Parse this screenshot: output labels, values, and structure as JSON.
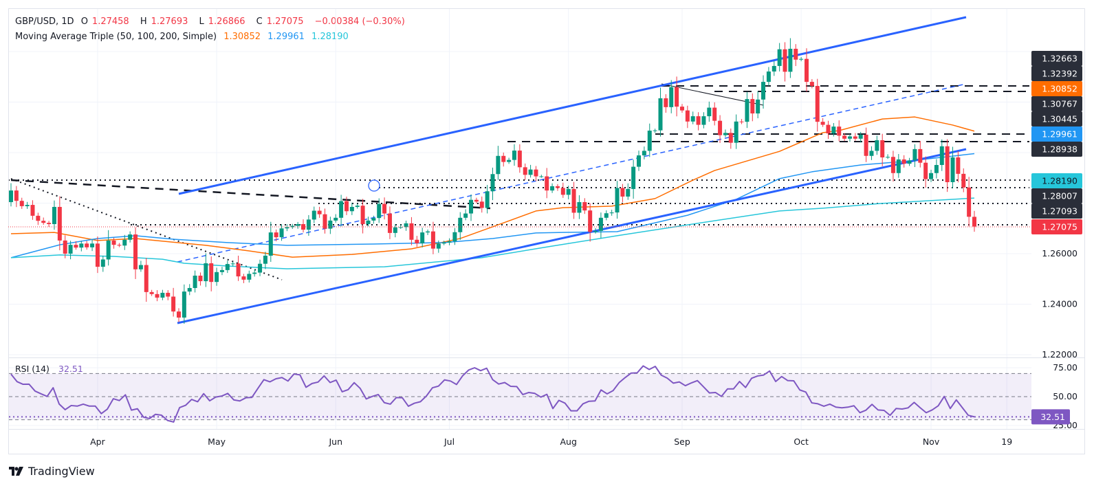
{
  "header": {
    "symbol": "GBP/USD, 1D",
    "open_label": "O",
    "open": "1.27458",
    "high_label": "H",
    "high": "1.27693",
    "low_label": "L",
    "low": "1.26866",
    "close_label": "C",
    "close": "1.27075",
    "change": "−0.00384 (−0.30%)",
    "ma_title": "Moving Average Triple (50, 100, 200, Simple)",
    "ma50_value": "1.30852",
    "ma100_value": "1.29961",
    "ma200_value": "1.28190"
  },
  "rsi_header": {
    "title": "RSI (14)",
    "value": "32.51"
  },
  "colors": {
    "up": "#089981",
    "down": "#f23645",
    "ma50": "#ff6d00",
    "ma100": "#2196f3",
    "ma200": "#26c6da",
    "channel": "#2962ff",
    "rsi": "#7e57c2",
    "label_dark": "#2a2e39"
  },
  "price_axis": {
    "ticks": [
      "1.26000",
      "1.24000",
      "1.22000"
    ]
  },
  "price_labels": [
    {
      "text": "1.32663",
      "kind": "level"
    },
    {
      "text": "1.32392",
      "kind": "level"
    },
    {
      "text": "1.30852",
      "kind": "ma50"
    },
    {
      "text": "1.30767",
      "kind": "level"
    },
    {
      "text": "1.30445",
      "kind": "level"
    },
    {
      "text": "1.29961",
      "kind": "ma100"
    },
    {
      "text": "1.28938",
      "kind": "level"
    },
    {
      "text": "1.28190",
      "kind": "ma200"
    },
    {
      "text": "1.28007",
      "kind": "level"
    },
    {
      "text": "1.27093",
      "kind": "level"
    },
    {
      "text": "1.27075",
      "kind": "last"
    }
  ],
  "rsi_axis": {
    "ticks": [
      "75.00",
      "50.00",
      "25.00"
    ],
    "current": "32.51"
  },
  "time_axis": [
    {
      "label": "Apr",
      "bar": 16
    },
    {
      "label": "May",
      "bar": 38
    },
    {
      "label": "Jun",
      "bar": 60
    },
    {
      "label": "Jul",
      "bar": 81
    },
    {
      "label": "Aug",
      "bar": 103
    },
    {
      "label": "Sep",
      "bar": 124
    },
    {
      "label": "Oct",
      "bar": 146
    },
    {
      "label": "Nov",
      "bar": 170
    },
    {
      "label": "19",
      "bar": 184
    }
  ],
  "branding": "TradingView",
  "chart_data": {
    "type": "candlestick",
    "symbol": "GBP/USD",
    "interval": "1D",
    "ylim": [
      1.215,
      1.36
    ],
    "first_open": 1.2804,
    "last_bar": {
      "open": 1.27458,
      "high": 1.27693,
      "low": 1.26866,
      "close": 1.27075
    },
    "closes": [
      1.285,
      1.2809,
      1.2788,
      1.2793,
      1.275,
      1.273,
      1.2722,
      1.2717,
      1.2785,
      1.2652,
      1.26,
      1.2635,
      1.2624,
      1.264,
      1.2625,
      1.264,
      1.2548,
      1.2577,
      1.2652,
      1.2635,
      1.2632,
      1.2655,
      1.2676,
      1.2538,
      1.2555,
      1.2448,
      1.244,
      1.2426,
      1.2445,
      1.243,
      1.2371,
      1.2347,
      1.245,
      1.2464,
      1.2513,
      1.2491,
      1.2562,
      1.2488,
      1.2527,
      1.2535,
      1.2559,
      1.2561,
      1.251,
      1.2497,
      1.252,
      1.2525,
      1.256,
      1.2592,
      1.2684,
      1.2665,
      1.27,
      1.2705,
      1.271,
      1.2717,
      1.2695,
      1.2735,
      1.277,
      1.2756,
      1.2699,
      1.2731,
      1.2742,
      1.2808,
      1.2768,
      1.2785,
      1.279,
      1.2717,
      1.2731,
      1.2741,
      1.2797,
      1.2759,
      1.2682,
      1.2704,
      1.2705,
      1.272,
      1.2655,
      1.2641,
      1.2684,
      1.2688,
      1.262,
      1.264,
      1.2644,
      1.2649,
      1.2685,
      1.2742,
      1.2759,
      1.2813,
      1.2806,
      1.2781,
      1.2847,
      1.2915,
      1.2987,
      1.2963,
      1.2971,
      1.3008,
      1.2942,
      1.2912,
      1.2933,
      1.2906,
      1.2906,
      1.285,
      1.2867,
      1.286,
      1.2833,
      1.2856,
      1.2762,
      1.2804,
      1.2771,
      1.2686,
      1.269,
      1.2742,
      1.276,
      1.2763,
      1.286,
      1.2826,
      1.2856,
      1.2944,
      1.2989,
      1.3007,
      1.3087,
      1.3088,
      1.3215,
      1.318,
      1.3259,
      1.3182,
      1.3167,
      1.3123,
      1.3144,
      1.311,
      1.3144,
      1.3178,
      1.3126,
      1.3069,
      1.3078,
      1.3039,
      1.3123,
      1.3122,
      1.3212,
      1.3155,
      1.321,
      1.328,
      1.3321,
      1.3343,
      1.3409,
      1.332,
      1.3411,
      1.3368,
      1.3371,
      1.328,
      1.3264,
      1.3122,
      1.311,
      1.3076,
      1.3103,
      1.3067,
      1.3055,
      1.3064,
      1.3055,
      1.3071,
      1.2987,
      1.3007,
      1.3049,
      1.2981,
      1.2983,
      1.2919,
      1.2973,
      1.2956,
      1.2969,
      1.3014,
      1.296,
      1.2895,
      1.2919,
      1.2951,
      1.3025,
      1.2883,
      1.2981,
      1.2916,
      1.2862,
      1.2746,
      1.27075
    ],
    "moving_averages": [
      {
        "name": "SMA 50",
        "points": [
          [
            0,
            1.2679
          ],
          [
            8,
            1.2684
          ],
          [
            16,
            1.2652
          ],
          [
            23,
            1.266
          ],
          [
            36,
            1.2633
          ],
          [
            44,
            1.2611
          ],
          [
            52,
            1.2586
          ],
          [
            63,
            1.2597
          ],
          [
            74,
            1.2619
          ],
          [
            83,
            1.266
          ],
          [
            90,
            1.2714
          ],
          [
            97,
            1.2769
          ],
          [
            102,
            1.2782
          ],
          [
            111,
            1.2788
          ],
          [
            119,
            1.2818
          ],
          [
            126,
            1.2891
          ],
          [
            130,
            1.2929
          ],
          [
            142,
            1.3005
          ],
          [
            150,
            1.3079
          ],
          [
            153,
            1.3087
          ],
          [
            161,
            1.3133
          ],
          [
            167,
            1.3141
          ],
          [
            174,
            1.3109
          ],
          [
            178,
            1.3085
          ]
        ]
      },
      {
        "name": "SMA 100",
        "points": [
          [
            0,
            1.2584
          ],
          [
            9,
            1.2635
          ],
          [
            16,
            1.266
          ],
          [
            23,
            1.2671
          ],
          [
            30,
            1.2657
          ],
          [
            40,
            1.2644
          ],
          [
            51,
            1.2633
          ],
          [
            67,
            1.2638
          ],
          [
            80,
            1.2644
          ],
          [
            89,
            1.266
          ],
          [
            97,
            1.2682
          ],
          [
            102,
            1.2684
          ],
          [
            112,
            1.2687
          ],
          [
            125,
            1.2752
          ],
          [
            134,
            1.2815
          ],
          [
            142,
            1.2897
          ],
          [
            148,
            1.2924
          ],
          [
            157,
            1.2951
          ],
          [
            165,
            1.2965
          ],
          [
            174,
            1.2986
          ],
          [
            178,
            1.2996
          ]
        ]
      },
      {
        "name": "SMA 200",
        "points": [
          [
            0,
            1.2584
          ],
          [
            9,
            1.2595
          ],
          [
            19,
            1.2589
          ],
          [
            28,
            1.2578
          ],
          [
            32,
            1.2562
          ],
          [
            40,
            1.2551
          ],
          [
            51,
            1.254
          ],
          [
            69,
            1.2548
          ],
          [
            87,
            1.2584
          ],
          [
            100,
            1.263
          ],
          [
            112,
            1.2671
          ],
          [
            125,
            1.2714
          ],
          [
            142,
            1.2769
          ],
          [
            150,
            1.278
          ],
          [
            161,
            1.2799
          ],
          [
            178,
            1.282
          ]
        ]
      }
    ],
    "rsi": {
      "period": 14,
      "ylim": [
        20,
        80
      ],
      "upper_band": 70,
      "middle": 50,
      "lower_band": 30,
      "values": [
        69.5,
        63,
        60.7,
        60.8,
        54.8,
        52.4,
        50.2,
        57.7,
        43.6,
        38.7,
        42.3,
        41.8,
        43.5,
        41.8,
        41.8,
        35.3,
        39.2,
        48.2,
        46.6,
        51.6,
        38.3,
        39.5,
        32.3,
        31,
        34.7,
        33.9,
        29.4,
        28,
        40.5,
        42.5,
        47.6,
        45.6,
        52.6,
        46.4,
        49.6,
        50.5,
        52.8,
        47.2,
        46.3,
        49,
        49.3,
        57.1,
        64.7,
        62.8,
        65.5,
        66.5,
        63.5,
        69.6,
        68.8,
        58.1,
        61.4,
        62.6,
        68,
        62.2,
        64.3,
        54.2,
        56.1,
        62.1,
        57.1,
        48,
        50.2,
        51.8,
        44.8,
        43.5,
        49.2,
        49,
        41.7,
        44.3,
        45.6,
        50.6,
        57.7,
        59.1,
        64.5,
        63.5,
        60.5,
        68,
        73,
        75,
        72.5,
        74.6,
        64.7,
        60.9,
        62.2,
        58.9,
        58.7,
        51.8,
        53.6,
        52.8,
        49.6,
        52,
        39.7,
        46.8,
        44.4,
        37.7,
        37.7,
        43.8,
        46,
        46.3,
        55.8,
        52.4,
        55.2,
        62.1,
        66.5,
        70.4,
        70.6,
        76.6,
        73.5,
        76.2,
        68.6,
        66,
        61.7,
        62.7,
        59.5,
        61.9,
        63.9,
        58.6,
        53.2,
        53.6,
        50.2,
        56.7,
        56.7,
        63.1,
        57.9,
        65.9,
        67.9,
        68.7,
        72.2,
        63.1,
        67.4,
        63.9,
        63.7,
        55.8,
        54,
        44.6,
        43.8,
        41.7,
        43.5,
        40.9,
        40.3,
        40.9,
        42.1,
        36.1,
        38.3,
        43.3,
        38.5,
        38.1,
        33.8,
        39.7,
        39.3,
        40.3,
        45,
        40.4,
        36.1,
        38.5,
        42.1,
        50.2,
        39.7,
        47.2,
        40.5,
        33.8,
        32.51
      ]
    }
  }
}
